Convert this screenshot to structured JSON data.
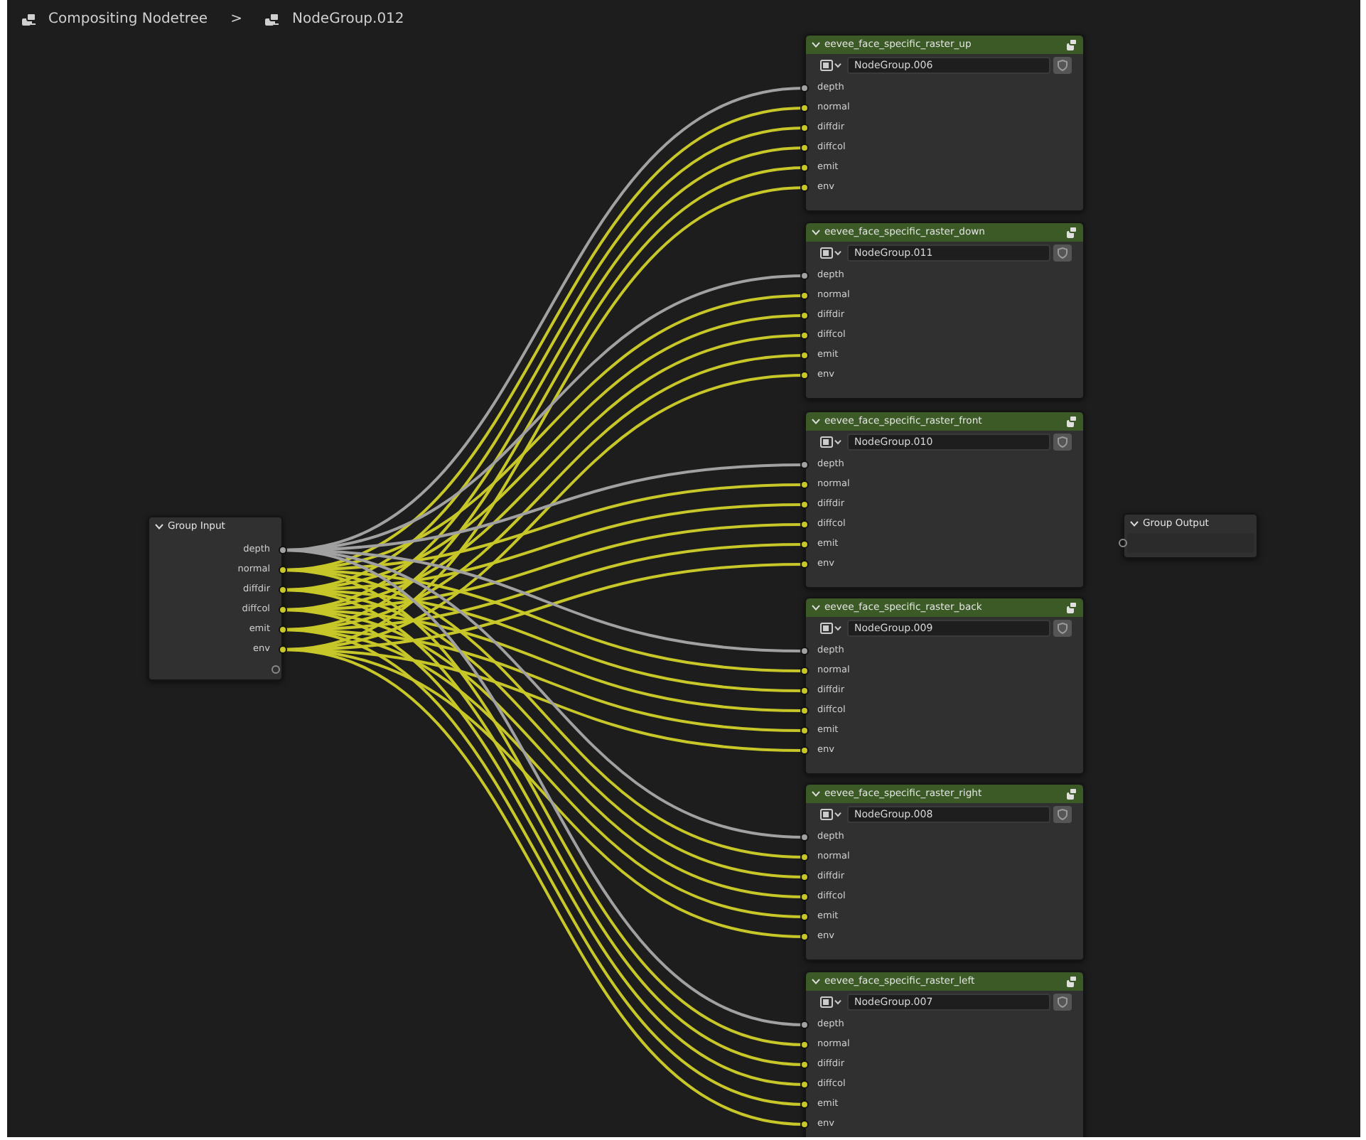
{
  "breadcrumb": [
    {
      "label": "Compositing Nodetree"
    },
    {
      "label": "NodeGroup.012"
    }
  ],
  "breadcrumb_separator": ">",
  "group_input": {
    "title": "Group Input",
    "expanded": true,
    "sockets": [
      {
        "label": "depth",
        "kind": "value"
      },
      {
        "label": "normal",
        "kind": "color"
      },
      {
        "label": "diffdir",
        "kind": "color"
      },
      {
        "label": "diffcol",
        "kind": "color"
      },
      {
        "label": "emit",
        "kind": "color"
      },
      {
        "label": "env",
        "kind": "color"
      }
    ]
  },
  "group_nodes": [
    {
      "title": "eevee_face_specific_raster_up",
      "expanded": true,
      "node_group": "NodeGroup.006",
      "inputs": [
        {
          "label": "depth",
          "kind": "value"
        },
        {
          "label": "normal",
          "kind": "color"
        },
        {
          "label": "diffdir",
          "kind": "color"
        },
        {
          "label": "diffcol",
          "kind": "color"
        },
        {
          "label": "emit",
          "kind": "color"
        },
        {
          "label": "env",
          "kind": "color"
        }
      ]
    },
    {
      "title": "eevee_face_specific_raster_down",
      "expanded": true,
      "node_group": "NodeGroup.011",
      "inputs": [
        {
          "label": "depth",
          "kind": "value"
        },
        {
          "label": "normal",
          "kind": "color"
        },
        {
          "label": "diffdir",
          "kind": "color"
        },
        {
          "label": "diffcol",
          "kind": "color"
        },
        {
          "label": "emit",
          "kind": "color"
        },
        {
          "label": "env",
          "kind": "color"
        }
      ]
    },
    {
      "title": "eevee_face_specific_raster_front",
      "expanded": true,
      "node_group": "NodeGroup.010",
      "inputs": [
        {
          "label": "depth",
          "kind": "value"
        },
        {
          "label": "normal",
          "kind": "color"
        },
        {
          "label": "diffdir",
          "kind": "color"
        },
        {
          "label": "diffcol",
          "kind": "color"
        },
        {
          "label": "emit",
          "kind": "color"
        },
        {
          "label": "env",
          "kind": "color"
        }
      ]
    },
    {
      "title": "eevee_face_specific_raster_back",
      "expanded": true,
      "node_group": "NodeGroup.009",
      "inputs": [
        {
          "label": "depth",
          "kind": "value"
        },
        {
          "label": "normal",
          "kind": "color"
        },
        {
          "label": "diffdir",
          "kind": "color"
        },
        {
          "label": "diffcol",
          "kind": "color"
        },
        {
          "label": "emit",
          "kind": "color"
        },
        {
          "label": "env",
          "kind": "color"
        }
      ]
    },
    {
      "title": "eevee_face_specific_raster_right",
      "expanded": true,
      "node_group": "NodeGroup.008",
      "inputs": [
        {
          "label": "depth",
          "kind": "value"
        },
        {
          "label": "normal",
          "kind": "color"
        },
        {
          "label": "diffdir",
          "kind": "color"
        },
        {
          "label": "diffcol",
          "kind": "color"
        },
        {
          "label": "emit",
          "kind": "color"
        },
        {
          "label": "env",
          "kind": "color"
        }
      ]
    },
    {
      "title": "eevee_face_specific_raster_left",
      "expanded": true,
      "node_group": "NodeGroup.007",
      "inputs": [
        {
          "label": "depth",
          "kind": "value"
        },
        {
          "label": "normal",
          "kind": "color"
        },
        {
          "label": "diffdir",
          "kind": "color"
        },
        {
          "label": "diffcol",
          "kind": "color"
        },
        {
          "label": "emit",
          "kind": "color"
        },
        {
          "label": "env",
          "kind": "color"
        }
      ]
    }
  ],
  "group_output": {
    "title": "Group Output",
    "expanded": true
  }
}
